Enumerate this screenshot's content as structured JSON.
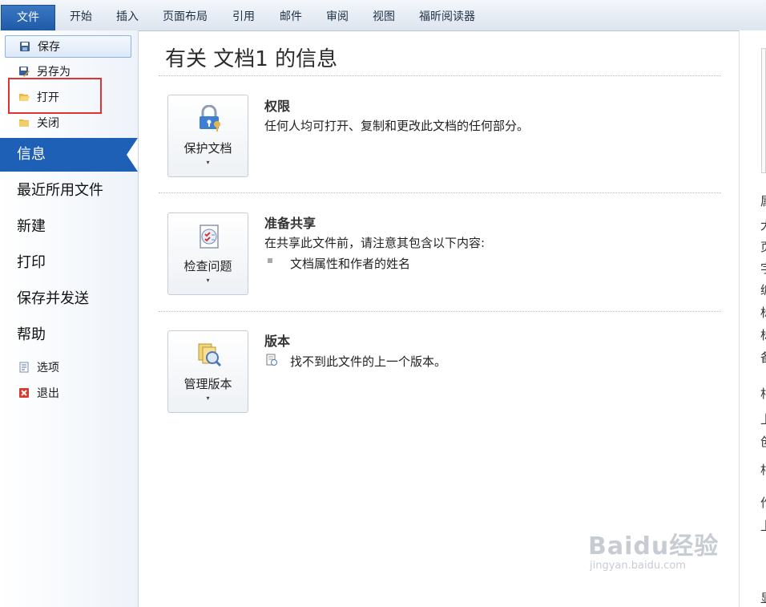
{
  "ribbon": {
    "file_tab": "文件",
    "tabs": [
      "开始",
      "插入",
      "页面布局",
      "引用",
      "邮件",
      "审阅",
      "视图",
      "福昕阅读器"
    ]
  },
  "sidebar": {
    "commands": [
      {
        "label": "保存",
        "icon": "save-icon"
      },
      {
        "label": "另存为",
        "icon": "save-as-icon"
      },
      {
        "label": "打开",
        "icon": "open-folder-icon"
      },
      {
        "label": "关闭",
        "icon": "close-folder-icon"
      }
    ],
    "nav": [
      "信息",
      "最近所用文件",
      "新建",
      "打印",
      "保存并发送",
      "帮助"
    ],
    "active_nav": "信息",
    "bottom": [
      {
        "label": "选项",
        "icon": "options-icon"
      },
      {
        "label": "退出",
        "icon": "exit-icon"
      }
    ]
  },
  "main": {
    "title": "有关 文档1 的信息",
    "sections": [
      {
        "button": "保护文档",
        "icon": "lock-keys-icon",
        "heading": "权限",
        "description": "任何人均可打开、复制和更改此文档的任何部分。"
      },
      {
        "button": "检查问题",
        "icon": "checklist-icon",
        "heading": "准备共享",
        "description": "在共享此文件前，请注意其包含以下内容:",
        "items": [
          "文档属性和作者的姓名"
        ]
      },
      {
        "button": "管理版本",
        "icon": "versions-icon",
        "heading": "版本",
        "items": [
          "找不到此文件的上一个版本。"
        ]
      }
    ]
  },
  "right_pane": {
    "partial_text": [
      "属",
      "大",
      "页",
      "字",
      "编",
      "标",
      "标",
      "备",
      "相",
      "上",
      "创",
      "相",
      "作",
      "上",
      "显"
    ]
  },
  "watermark": {
    "line1": "Baidu经验",
    "line2": "jingyan.baidu.com"
  },
  "colors": {
    "accent": "#1e60b6",
    "highlight_box": "#e03434"
  }
}
